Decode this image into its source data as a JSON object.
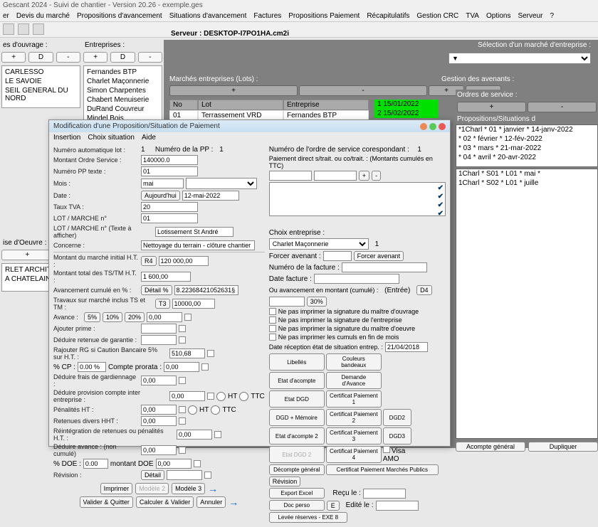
{
  "app": {
    "title": "Gescant 2024 - Suivi de chantier - Version 20.26 - exemple.ges"
  },
  "menu": [
    "er",
    "Devis du marché",
    "Propositions d'avancement",
    "Situations d'avancement",
    "Factures",
    "Propositions Paiement",
    "Récapitulatifs",
    "Gestion CRC",
    "TVA",
    "Options",
    "Serveur",
    "?"
  ],
  "server": {
    "label": "Serveur : DESKTOP-I7PO1HA.cm2i"
  },
  "left": {
    "ouvrage_hdr": "es d'ouvrage :",
    "entreprises_hdr": "Entreprises :",
    "plus": "+",
    "d": "D",
    "minus": "-",
    "ouvrage_list": [
      "CARLESSO",
      "LE SAVOIE",
      "SEIL GENERAL DU NORD"
    ],
    "ent_list": [
      "Fernandes BTP",
      "Charlet Maçonnerie",
      "Simon Charpentes",
      "Chabert Menuiserie",
      "DuRand Couvreur",
      "Mindel Bois"
    ],
    "oeuvre_hdr": "ise d'Oeuvre :",
    "oeuvre_list": [
      "RLET ARCHITEC",
      "A CHATELAIN R"
    ]
  },
  "mid": {
    "sel_label": "Sélection d'un marché d'entreprise :",
    "lots_label": "Marchés entreprises (Lots) :",
    "avenants_label": "Gestion des avenants :",
    "ordres_label": "Ordres de service :",
    "props_label": "Propositions/Situations d",
    "tbl_hdr": [
      "No",
      "Lot",
      "Entreprise"
    ],
    "tbl_row": [
      "01",
      "Terrassement VRD",
      "Fernandes BTP"
    ],
    "dates": [
      "1 15/01/2022",
      "2 15/02/2022"
    ],
    "ordres": [
      "*1Charl * 01 * janvier * 14-janv-2022",
      "* 02 * février * 12-fév-2022",
      "* 03 * mars * 21-mar-2022",
      "* 04 * avril * 20-avr-2022"
    ],
    "props": [
      "1Charl * S01 * L01 * mai *",
      "1Charl * S02 * L01 * juille"
    ],
    "acompte": "Acompte général",
    "dupliquer": "Dupliquer"
  },
  "dlg": {
    "title": "Modification d'une Proposition/Situation de Paiement",
    "menu": [
      "Insertion",
      "Choix situation",
      "Aide"
    ],
    "num_auto": "Numéro automatique lot :",
    "num_auto_v": "1",
    "num_pp": "Numéro de la PP :",
    "num_pp_v": "1",
    "num_ordre": "Numéro de l'ordre de service corespondant :",
    "num_ordre_v": "1",
    "montant_os": "Montant Ordre Service :",
    "montant_os_v": "140000.0",
    "paiement": "Paiement direct s/trait. ou co/trait. : (Montants cumulés en TTC)",
    "num_pp_txt": "Numéro PP texte :",
    "num_pp_txt_v": "01",
    "mois": "Mois :",
    "mois_v": "mai",
    "date": "Date :",
    "date_v": "12-mai-2022",
    "aujourd": "Aujourd'hui",
    "taux_tva": "Taux TVA :",
    "taux_tva_v": "20",
    "lot_n": "LOT / MARCHE n°",
    "lot_n_v": "01",
    "lot_txt": "LOT / MARCHE n° (Texte à afficher)",
    "lot_txt_v": "Lotissement St André",
    "concerne": "Concerne :",
    "concerne_v": "Nettoyage du terrain - clôture chantier",
    "choix_ent": "Choix entreprise :",
    "choix_ent_v": "Charlet Maçonnerie",
    "choix_ent_n": "1",
    "forcer_av": "Forcer avenant :",
    "forcer_av_btn": "Forcer avenant",
    "num_fact": "Numéro de la facture :",
    "date_fact": "Date facture :",
    "ou_av": "Ou avancement en montant (cumulé) :",
    "entree": "(Entrée)",
    "d4": "D4",
    "thirty": "30%",
    "chk1": "Ne pas imprimer la signature du maître d'ouvrage",
    "chk2": "Ne pas imprimer la signature de l'entreprise",
    "chk3": "Ne pas imprimer la signature du maître d'oeuvre",
    "chk4": "Ne pas imprimer les cumuls en fin de mois",
    "date_recep": "Date réception état de situation entrep. :",
    "date_recep_v": "21/04/2018",
    "m_init": "Montant du marché initial H.T. :",
    "r4": "R4",
    "m_init_v": "120 000,00",
    "m_tstm": "Montant total des TS/TM H.T. :",
    "m_tstm_v": "1 600,00",
    "av_cum": "Avancement cumulé en % :",
    "detail_pc": "Détail %",
    "av_cum_v": "8.22368421052631§",
    "trav": "Travaux sur marché inclus TS et TM :",
    "t3": "T3",
    "trav_v": "10000,00",
    "avance": "Avance :",
    "p5": "5%",
    "p10": "10%",
    "p20": "20%",
    "avance_v": "0,00",
    "aj_prime": "Ajouter prime :",
    "ded_ret": "Déduire retenue de garantie :",
    "raj_rg": "Rajouter RG si Caution Bancaire 5% sur H.T. :",
    "raj_rg_v": "510,68",
    "cp": "% CP :",
    "cp_v": "0.00 %",
    "cp_lbl": "Compte prorata :",
    "cp2_v": "0,00",
    "ded_frais": "Déduire frais de gardiennage :",
    "zero": "0,00",
    "ded_prov": "Déduire provision compte inter entreprise :",
    "pen_ht": "Pénalités HT :",
    "ret_div": "Retenues divers HHT :",
    "reint": "Réintégration de retenues ou pénalités H.T. :",
    "ded_av": "Déduire avance : (non cumulé)",
    "doe": "% DOE :",
    "doe_v": "0.00",
    "doe_lbl": "montant DOE",
    "doe2_v": "0,00",
    "ht": "HT",
    "ttc": "TTC",
    "revision": "Révision :",
    "detail": "Détail",
    "rev_btn": "Révision",
    "imprimer": "Imprimer",
    "mod2": "Modèle 2",
    "mod3": "Modèle 3",
    "valider_q": "Valider & Quitter",
    "calc_v": "Calculer & Valider",
    "annuler": "Annuler",
    "libelles": "Libellés",
    "coul": "Couleurs bandeaux",
    "etat_ac": "Etat d'acompte",
    "dem_av": "Demande d'Avance",
    "etat_dgd": "Etat DGD",
    "cert1": "Certificat Paiement 1",
    "dgd_mem": "DGD + Mémoire",
    "cert2": "Certificat Paiement 2",
    "dgd2": "DGD2",
    "etat_ac2": "Etat d'acompte 2",
    "cert3": "Certificat Paiement 3",
    "dgd3": "DGD3",
    "etat_dgd2": "Etat DGD 2",
    "cert4": "Certificat Paiement 4",
    "visa": "Visa AMO",
    "dec_gen": "Décompte général",
    "cert_mp": "Certificat Paiement Marchés Publics",
    "exp_excel": "Export Excel",
    "doc_perso": "Doc perso",
    "e": "E",
    "levee": "Levée réserves - EXE 8",
    "recu": "Reçu le :",
    "edite": "Edité le :"
  }
}
